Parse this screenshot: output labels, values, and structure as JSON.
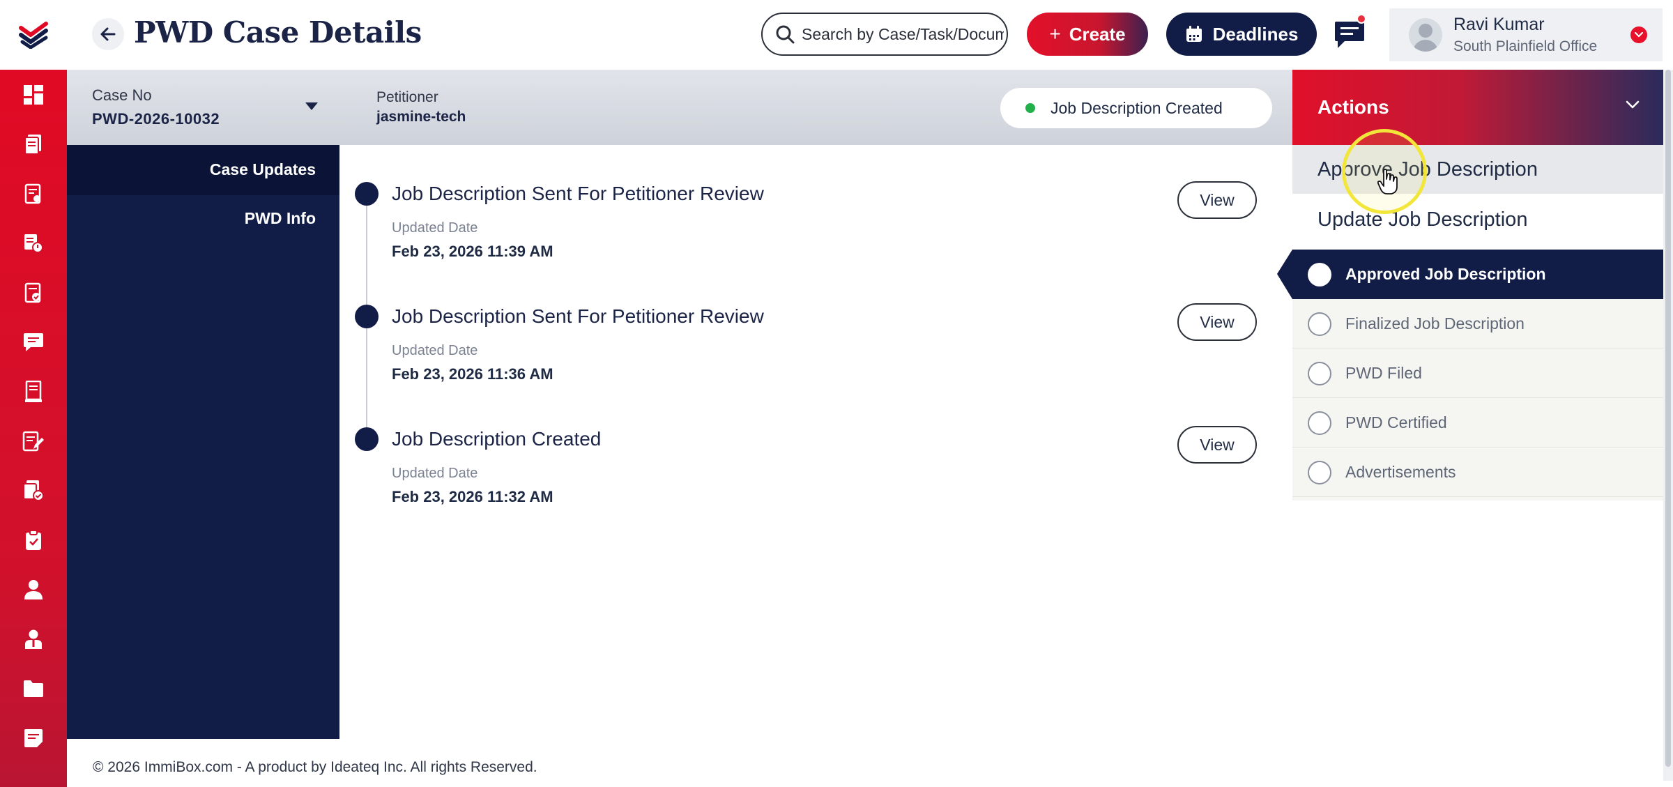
{
  "header": {
    "title": "PWD Case Details",
    "search_placeholder": "Search by Case/Task/Document",
    "create_label": "Create",
    "deadlines_label": "Deadlines"
  },
  "user": {
    "name": "Ravi Kumar",
    "office": "South Plainfield Office"
  },
  "case_info": {
    "case_no_label": "Case No",
    "case_no": "PWD-2026-10032",
    "petitioner_label": "Petitioner",
    "petitioner": "jasmine-tech",
    "status": "Job Description Created",
    "status_color": "#22b04a"
  },
  "subnav": {
    "items": [
      {
        "label": "Case Updates",
        "active": true
      },
      {
        "label": "PWD Info",
        "active": false
      }
    ]
  },
  "timeline": {
    "entries": [
      {
        "title": "Job Description Sent For Petitioner Review",
        "date_label": "Updated Date",
        "date": "Feb 23, 2026 11:39 AM",
        "view_label": "View"
      },
      {
        "title": "Job Description Sent For Petitioner Review",
        "date_label": "Updated Date",
        "date": "Feb 23, 2026 11:36 AM",
        "view_label": "View"
      },
      {
        "title": "Job Description Created",
        "date_label": "Updated Date",
        "date": "Feb 23, 2026 11:32 AM",
        "view_label": "View"
      }
    ]
  },
  "actions": {
    "title": "Actions",
    "items": [
      {
        "label": "Approve Job Description"
      },
      {
        "label": "Update Job Description"
      }
    ],
    "steps": [
      {
        "label": "Approved Job Description",
        "active": true
      },
      {
        "label": "Finalized Job Description",
        "active": false
      },
      {
        "label": "PWD Filed",
        "active": false
      },
      {
        "label": "PWD Certified",
        "active": false
      },
      {
        "label": "Advertisements",
        "active": false
      }
    ]
  },
  "rail_icons": [
    "dashboard-icon",
    "document-icon",
    "task-list-icon",
    "case-alert-icon",
    "checklist-icon",
    "message-icon",
    "book-icon",
    "edit-form-icon",
    "verified-file-icon",
    "clipboard-icon",
    "user-icon",
    "profile-icon",
    "folder-icon",
    "note-icon"
  ],
  "footer": {
    "text": "© 2026 ImmiBox.com - A product by Ideateq Inc. All rights Reserved."
  },
  "colors": {
    "brand_red": "#e10a24",
    "navy": "#111c47"
  }
}
